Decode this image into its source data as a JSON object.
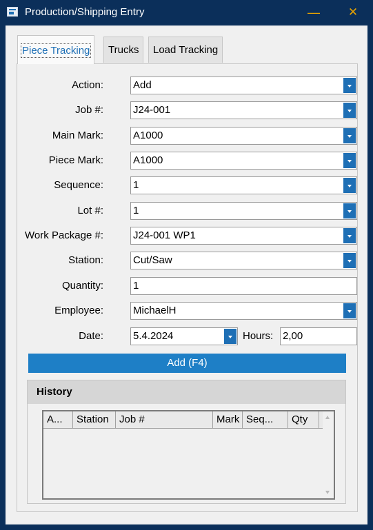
{
  "window": {
    "title": "Production/Shipping Entry",
    "minimize_glyph": "—",
    "close_glyph": "✕"
  },
  "tabs": [
    {
      "label": "Piece Tracking",
      "active": true
    },
    {
      "label": "Trucks",
      "active": false
    },
    {
      "label": "Load Tracking",
      "active": false
    }
  ],
  "form": {
    "action": {
      "label": "Action:",
      "value": "Add"
    },
    "job": {
      "label": "Job #:",
      "value": "J24-001"
    },
    "main_mark": {
      "label": "Main Mark:",
      "value": "A1000"
    },
    "piece_mark": {
      "label": "Piece Mark:",
      "value": "A1000"
    },
    "sequence": {
      "label": "Sequence:",
      "value": "1"
    },
    "lot": {
      "label": "Lot #:",
      "value": "1"
    },
    "work_package": {
      "label": "Work Package #:",
      "value": "J24-001 WP1"
    },
    "station": {
      "label": "Station:",
      "value": "Cut/Saw"
    },
    "quantity": {
      "label": "Quantity:",
      "value": "1"
    },
    "employee": {
      "label": "Employee:",
      "value": "MichaelH"
    },
    "date": {
      "label": "Date:",
      "value": "5.4.2024"
    },
    "hours": {
      "label": "Hours:",
      "value": "2,00"
    }
  },
  "add_button": {
    "label": "Add (F4)"
  },
  "history": {
    "title": "History",
    "columns": [
      "A...",
      "Station",
      "Job #",
      "Mark",
      "Seq...",
      "Qty"
    ],
    "rows": []
  },
  "colors": {
    "accent": "#1e7fc6",
    "titlebar": "#0b2f5a",
    "window_controls": "#e9a400"
  }
}
